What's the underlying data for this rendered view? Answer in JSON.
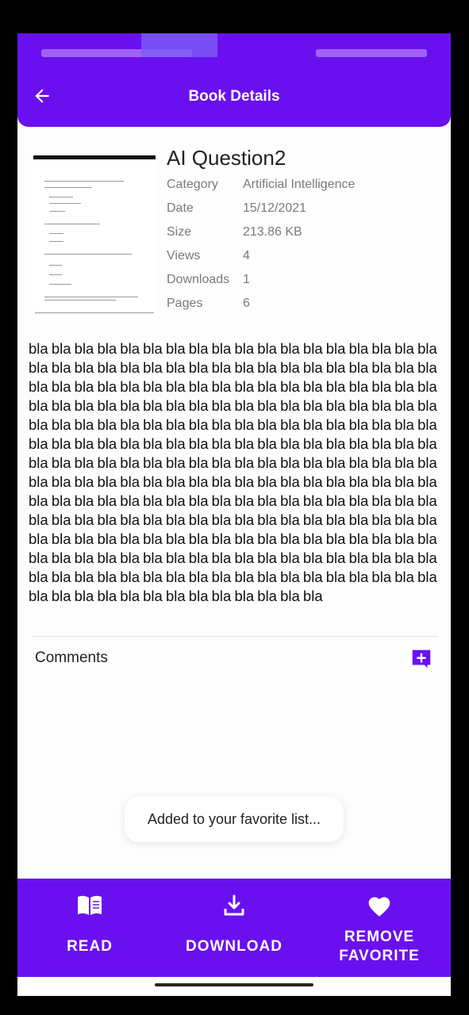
{
  "app_bar": {
    "title": "Book Details"
  },
  "book": {
    "title": "AI Question2",
    "meta": [
      {
        "label": "Category",
        "value": "Artificial Intelligence"
      },
      {
        "label": "Date",
        "value": "15/12/2021"
      },
      {
        "label": "Size",
        "value": "213.86 KB"
      },
      {
        "label": "Views",
        "value": "4"
      },
      {
        "label": "Downloads",
        "value": "1"
      },
      {
        "label": "Pages",
        "value": "6"
      }
    ],
    "description": "bla bla bla bla bla bla bla bla bla bla bla bla bla bla bla bla bla bla bla bla bla bla bla bla bla bla bla bla bla bla bla bla bla bla bla bla bla bla bla bla bla bla bla bla bla bla bla bla bla bla bla bla bla bla bla bla bla bla bla bla bla bla bla bla bla bla bla bla bla bla bla bla bla bla bla bla bla bla bla bla bla bla bla bla bla bla bla bla bla bla bla bla bla bla bla bla bla bla bla bla bla bla bla bla bla bla bla bla bla bla bla bla bla bla bla bla bla bla bla bla bla bla bla bla bla bla bla bla bla bla bla bla bla bla bla bla bla bla bla bla bla bla bla bla bla bla bla bla bla bla bla bla bla bla bla bla bla bla bla bla bla bla bla bla bla bla bla bla bla bla bla bla bla bla bla bla bla bla bla bla bla bla bla bla bla bla bla bla bla bla bla bla bla bla bla bla bla bla bla bla bla bla bla bla bla bla bla bla bla bla bla bla bla bla bla bla bla bla bla bla bla bla bla bla bla bla bla bla bla bla bla bla bla bla bla bla bla bla bla bla bla bla bla bla bla bla bla"
  },
  "comments": {
    "label": "Comments"
  },
  "toast": {
    "message": "Added to your favorite list..."
  },
  "actions": {
    "read": "READ",
    "download": "DOWNLOAD",
    "favorite": "REMOVE\nFAVORITE"
  },
  "icons": {
    "back": "arrow-left-icon",
    "add_comment": "add-comment-icon",
    "read": "open-book-icon",
    "download": "download-icon",
    "favorite": "heart-icon"
  },
  "colors": {
    "primary": "#6a10f0",
    "background": "#fdfdfd",
    "meta_text": "#7a7a7a"
  }
}
